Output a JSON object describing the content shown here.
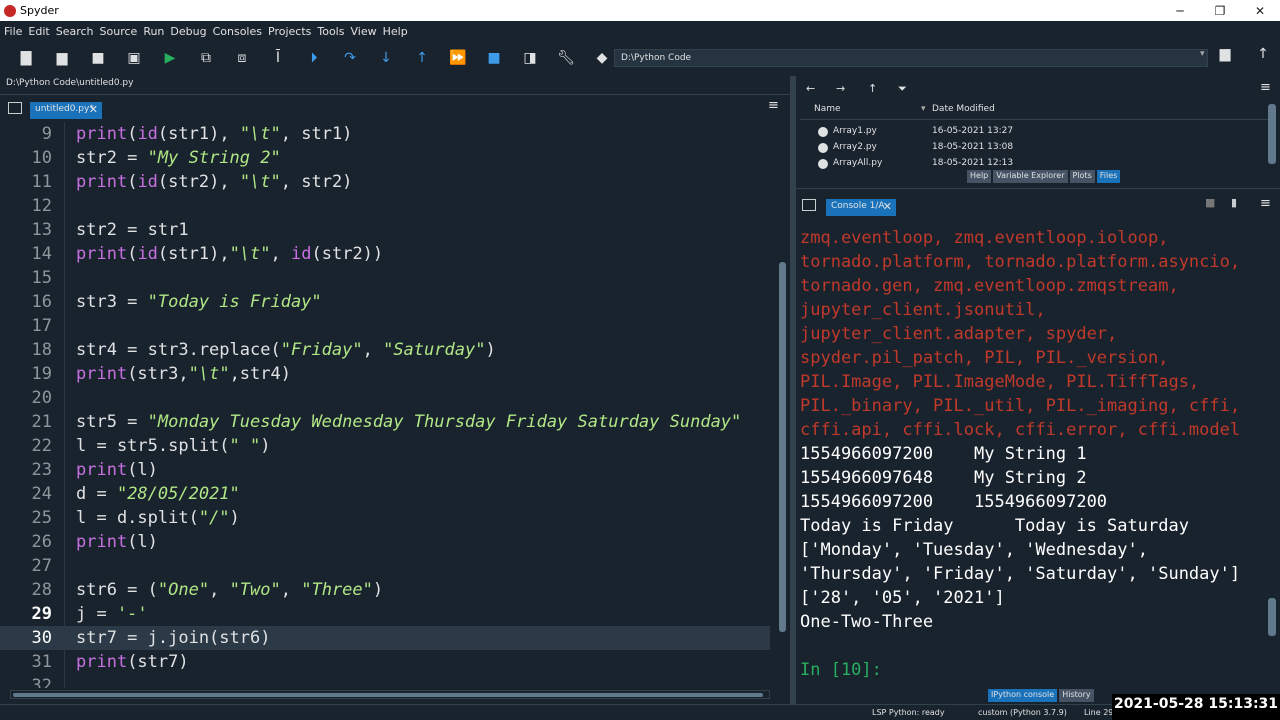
{
  "window": {
    "title": "Spyder",
    "minimize": "─",
    "maximize": "❐",
    "close": "✕"
  },
  "menu": [
    "File",
    "Edit",
    "Search",
    "Source",
    "Run",
    "Debug",
    "Consoles",
    "Projects",
    "Tools",
    "View",
    "Help"
  ],
  "toolbar": {
    "working_dir": "D:\\Python Code"
  },
  "editor": {
    "file_path": "D:\\Python Code\\untitled0.py",
    "tab_label": "untitled0.py*",
    "tab_close": "✕",
    "current_line": 29,
    "lines": [
      {
        "num": "9",
        "segments": [
          [
            "b",
            "print"
          ],
          [
            "t",
            "("
          ],
          [
            "b",
            "id"
          ],
          [
            "t",
            "(str1), "
          ],
          [
            "s",
            "\"\\t\""
          ],
          [
            "t",
            ", str1)"
          ]
        ]
      },
      {
        "num": "10",
        "segments": [
          [
            "t",
            "str2 = "
          ],
          [
            "s",
            "\"My String 2\""
          ]
        ]
      },
      {
        "num": "11",
        "segments": [
          [
            "b",
            "print"
          ],
          [
            "t",
            "("
          ],
          [
            "b",
            "id"
          ],
          [
            "t",
            "(str2), "
          ],
          [
            "s",
            "\"\\t\""
          ],
          [
            "t",
            ", str2)"
          ]
        ]
      },
      {
        "num": "12",
        "segments": []
      },
      {
        "num": "13",
        "segments": [
          [
            "t",
            "str2 = str1"
          ]
        ]
      },
      {
        "num": "14",
        "segments": [
          [
            "b",
            "print"
          ],
          [
            "t",
            "("
          ],
          [
            "b",
            "id"
          ],
          [
            "t",
            "(str1),"
          ],
          [
            "s",
            "\"\\t\""
          ],
          [
            "t",
            ", "
          ],
          [
            "b",
            "id"
          ],
          [
            "t",
            "(str2))"
          ]
        ]
      },
      {
        "num": "15",
        "segments": []
      },
      {
        "num": "16",
        "segments": [
          [
            "t",
            "str3 = "
          ],
          [
            "s",
            "\"Today is Friday\""
          ]
        ]
      },
      {
        "num": "17",
        "segments": []
      },
      {
        "num": "18",
        "segments": [
          [
            "t",
            "str4 = str3.replace("
          ],
          [
            "s",
            "\"Friday\""
          ],
          [
            "t",
            ", "
          ],
          [
            "s",
            "\"Saturday\""
          ],
          [
            "t",
            ")"
          ]
        ]
      },
      {
        "num": "19",
        "segments": [
          [
            "b",
            "print"
          ],
          [
            "t",
            "(str3,"
          ],
          [
            "s",
            "\"\\t\""
          ],
          [
            "t",
            ",str4)"
          ]
        ]
      },
      {
        "num": "20",
        "segments": []
      },
      {
        "num": "21",
        "segments": [
          [
            "t",
            "str5 = "
          ],
          [
            "s",
            "\"Monday Tuesday Wednesday Thursday Friday Saturday Sunday\""
          ]
        ]
      },
      {
        "num": "22",
        "segments": [
          [
            "t",
            "l = str5.split("
          ],
          [
            "s",
            "\" \""
          ],
          [
            "t",
            ")"
          ]
        ]
      },
      {
        "num": "23",
        "segments": [
          [
            "b",
            "print"
          ],
          [
            "t",
            "(l)"
          ]
        ]
      },
      {
        "num": "24",
        "segments": [
          [
            "t",
            "d = "
          ],
          [
            "s",
            "\"28/05/2021\""
          ]
        ]
      },
      {
        "num": "25",
        "segments": [
          [
            "t",
            "l = d.split("
          ],
          [
            "s",
            "\"/\""
          ],
          [
            "t",
            ")"
          ]
        ]
      },
      {
        "num": "26",
        "segments": [
          [
            "b",
            "print"
          ],
          [
            "t",
            "(l)"
          ]
        ]
      },
      {
        "num": "27",
        "segments": []
      },
      {
        "num": "28",
        "segments": [
          [
            "t",
            "str6 = ("
          ],
          [
            "s",
            "\"One\""
          ],
          [
            "t",
            ", "
          ],
          [
            "s",
            "\"Two\""
          ],
          [
            "t",
            ", "
          ],
          [
            "s",
            "\"Three\""
          ],
          [
            "t",
            ")"
          ]
        ]
      },
      {
        "num": "29",
        "segments": [
          [
            "t",
            "j = "
          ],
          [
            "s",
            "'-'"
          ]
        ]
      },
      {
        "num": "30",
        "segments": [
          [
            "t",
            "str7 = j.join(str6)"
          ]
        ]
      },
      {
        "num": "31",
        "segments": [
          [
            "b",
            "print"
          ],
          [
            "t",
            "(str7)"
          ]
        ]
      },
      {
        "num": "32",
        "segments": []
      }
    ]
  },
  "files": {
    "columns": {
      "name": "Name",
      "date": "Date Modified"
    },
    "rows": [
      {
        "name": "Array1.py",
        "date": "16-05-2021 13:27"
      },
      {
        "name": "Array2.py",
        "date": "18-05-2021 13:08"
      },
      {
        "name": "ArrayAll.py",
        "date": "18-05-2021 12:13"
      }
    ],
    "tabs": [
      "Help",
      "Variable Explorer",
      "Plots",
      "Files"
    ],
    "active_tab": "Files"
  },
  "console": {
    "tab_label": "Console 1/A",
    "tab_close": "✕",
    "lines": [
      {
        "kind": "err",
        "text": "zmq.eventloop, zmq.eventloop.ioloop,"
      },
      {
        "kind": "err",
        "text": "tornado.platform, tornado.platform.asyncio,"
      },
      {
        "kind": "err",
        "text": "tornado.gen, zmq.eventloop.zmqstream,"
      },
      {
        "kind": "err",
        "text": "jupyter_client.jsonutil,"
      },
      {
        "kind": "err",
        "text": "jupyter_client.adapter, spyder,"
      },
      {
        "kind": "err",
        "text": "spyder.pil_patch, PIL, PIL._version,"
      },
      {
        "kind": "err",
        "text": "PIL.Image, PIL.ImageMode, PIL.TiffTags,"
      },
      {
        "kind": "err",
        "text": "PIL._binary, PIL._util, PIL._imaging, cffi,"
      },
      {
        "kind": "err",
        "text": "cffi.api, cffi.lock, cffi.error, cffi.model"
      },
      {
        "kind": "out",
        "text": "1554966097200    My String 1"
      },
      {
        "kind": "out",
        "text": "1554966097648    My String 2"
      },
      {
        "kind": "out",
        "text": "1554966097200    1554966097200"
      },
      {
        "kind": "out",
        "text": "Today is Friday      Today is Saturday"
      },
      {
        "kind": "out",
        "text": "['Monday', 'Tuesday', 'Wednesday',"
      },
      {
        "kind": "out",
        "text": "'Thursday', 'Friday', 'Saturday', 'Sunday']"
      },
      {
        "kind": "out",
        "text": "['28', '05', '2021']"
      },
      {
        "kind": "out",
        "text": "One-Two-Three"
      },
      {
        "kind": "out",
        "text": ""
      },
      {
        "kind": "prompt",
        "text": "In [10]:"
      }
    ],
    "bottom_tabs": [
      "IPython console",
      "History"
    ],
    "active_bottom_tab": "IPython console"
  },
  "statusbar": {
    "lsp": "LSP Python: ready",
    "interpreter": "custom (Python 3.7.9)",
    "line_col": "Line 29,"
  },
  "timestamp": "2021-05-28  15:13:31",
  "colors": {
    "background": "#19232d",
    "string": "#b0e686",
    "builtin": "#c670e0",
    "error_text": "#c0392b",
    "prompt": "#27ae60",
    "accent_tab": "#1a72bb"
  }
}
